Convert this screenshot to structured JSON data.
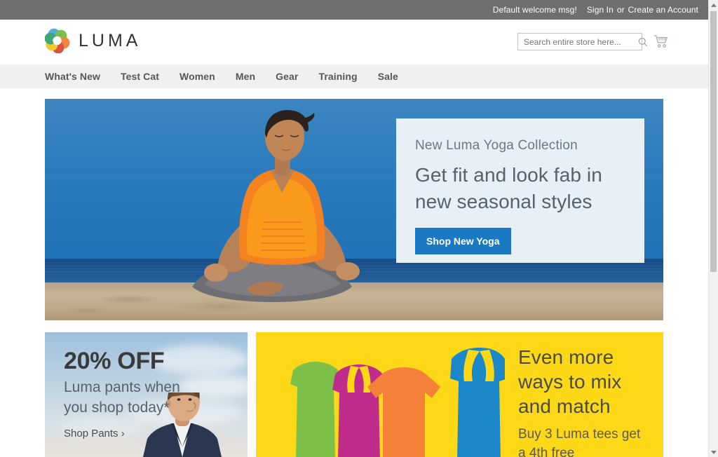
{
  "topbar": {
    "welcome": "Default welcome msg!",
    "sign_in": "Sign In",
    "separator": "or",
    "create_account": "Create an Account"
  },
  "header": {
    "logo_text": "LUMA",
    "logo_icon": "luma-flower-logo",
    "search": {
      "placeholder": "Search entire store here...",
      "value": "",
      "icon": "search-icon"
    },
    "cart": {
      "icon": "shopping-cart-icon",
      "count": ""
    }
  },
  "nav": {
    "items": [
      {
        "label": "What's New"
      },
      {
        "label": "Test Cat"
      },
      {
        "label": "Women"
      },
      {
        "label": "Men"
      },
      {
        "label": "Gear"
      },
      {
        "label": "Training"
      },
      {
        "label": "Sale"
      }
    ]
  },
  "hero": {
    "image_alt": "woman-meditating-on-beach",
    "eyebrow": "New Luma Yoga Collection",
    "title_line1": "Get fit and look fab in",
    "title_line2": "new seasonal styles",
    "cta_label": "Shop New Yoga",
    "cta_color": "#1979c3",
    "panel_color": "#e8eff5"
  },
  "promo_left": {
    "image_alt": "man-in-navy-jacket-sky-background",
    "headline": "20% OFF",
    "subline1": "Luma pants when",
    "subline2": "you shop today*",
    "link_label": "Shop Pants ›"
  },
  "promo_right": {
    "background_color": "#fcd817",
    "image_alt": "four-colored-tank-top-and-tee-silhouettes",
    "title_line1": "Even more",
    "title_line2": "ways to mix",
    "title_line3": "and match",
    "sub_line1": "Buy 3 Luma tees get",
    "sub_line2": "a 4th free",
    "garment_colors": [
      "#7cc04a",
      "#bf2c8c",
      "#f4803a",
      "#1d88c9"
    ]
  },
  "scrollbar": {
    "up_arrow_icon": "scroll-up-arrow-icon",
    "down_arrow_icon": "scroll-down-arrow-icon"
  }
}
